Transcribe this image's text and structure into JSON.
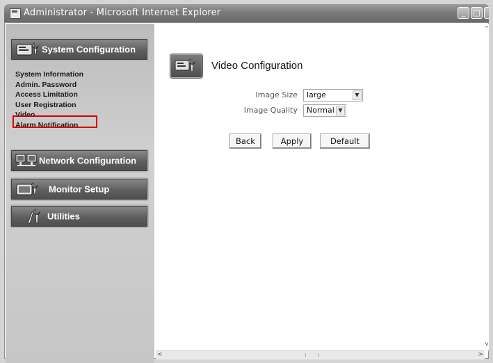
{
  "window": {
    "title": "Administrator - Microsoft Internet Explorer",
    "controls": {
      "minimize": "_",
      "maximize": "□",
      "close": "x"
    }
  },
  "sidebar": {
    "system_config": {
      "label": "System Configuration"
    },
    "links": [
      "System Information",
      "Admin. Password",
      "Access Limitation",
      "User Registration",
      "Video",
      "Alarm Notification"
    ],
    "selected": "Video",
    "network_config": {
      "label": "Network Configuration"
    },
    "monitor_setup": {
      "label": "Monitor Setup"
    },
    "utilities": {
      "label": "Utilities"
    }
  },
  "main": {
    "title": "Video Configuration",
    "image_size": {
      "label": "Image Size",
      "value": "large"
    },
    "image_quality": {
      "label": "Image Quality",
      "value": "Normal"
    },
    "buttons": {
      "back": "Back",
      "apply": "Apply",
      "default": "Default"
    }
  },
  "scrollbars": {
    "up": "^",
    "down": "v",
    "left": "<",
    "right": ">"
  }
}
